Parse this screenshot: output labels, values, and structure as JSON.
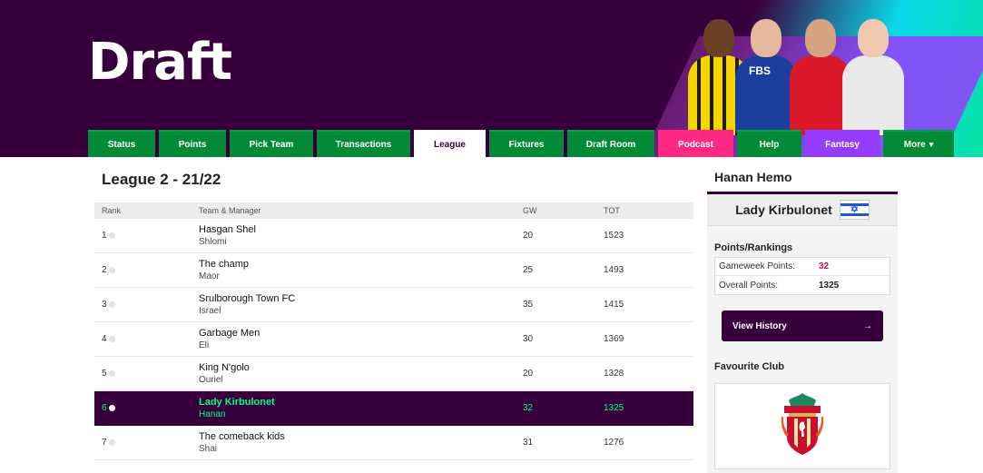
{
  "header": {
    "title": "Draft",
    "sponsor_text": "FBS"
  },
  "nav": {
    "tabs": [
      {
        "label": "Status",
        "width": 74,
        "style": "normal"
      },
      {
        "label": "Points",
        "width": 74,
        "style": "normal"
      },
      {
        "label": "Pick Team",
        "width": 92,
        "style": "normal"
      },
      {
        "label": "Transactions",
        "width": 103,
        "style": "normal"
      },
      {
        "label": "League",
        "width": 79,
        "style": "active"
      },
      {
        "label": "Fixtures",
        "width": 82,
        "style": "normal"
      },
      {
        "label": "Draft Room",
        "width": 96,
        "style": "normal"
      },
      {
        "label": "Podcast",
        "width": 83,
        "style": "podcast"
      },
      {
        "label": "Help",
        "width": 71,
        "style": "normal"
      },
      {
        "label": "Fantasy",
        "width": 82,
        "style": "fantasy"
      },
      {
        "label": "More",
        "width": 78,
        "style": "normal",
        "chevron": "▾"
      }
    ]
  },
  "league": {
    "title": "League 2 - 21/22",
    "columns": {
      "rank": "Rank",
      "team": "Team & Manager",
      "gw": "GW",
      "tot": "TOT"
    },
    "rows": [
      {
        "rank": "1",
        "team": "Hasgan Shel",
        "manager": "Shlomi",
        "gw": "20",
        "tot": "1523",
        "me": false
      },
      {
        "rank": "2",
        "team": "The champ",
        "manager": "Maor",
        "gw": "25",
        "tot": "1493",
        "me": false
      },
      {
        "rank": "3",
        "team": "Srulborough Town FC",
        "manager": "Israel",
        "gw": "35",
        "tot": "1415",
        "me": false
      },
      {
        "rank": "4",
        "team": "Garbage Men",
        "manager": "Eli",
        "gw": "30",
        "tot": "1369",
        "me": false
      },
      {
        "rank": "5",
        "team": "King N'golo",
        "manager": "Ouriel",
        "gw": "20",
        "tot": "1328",
        "me": false
      },
      {
        "rank": "6",
        "team": "Lady Kirbulonet",
        "manager": "Hanan",
        "gw": "32",
        "tot": "1325",
        "me": true
      },
      {
        "rank": "7",
        "team": "The comeback kids",
        "manager": "Shai",
        "gw": "31",
        "tot": "1276",
        "me": false
      }
    ]
  },
  "sidebar": {
    "owner_name": "Hanan Hemo",
    "team_name": "Lady Kirbulonet",
    "flag_icon": "israel-flag-icon",
    "points_title": "Points/Rankings",
    "gameweek_label": "Gameweek Points:",
    "gameweek_value": "32",
    "overall_label": "Overall Points:",
    "overall_value": "1325",
    "history_button": "View History",
    "history_arrow": "→",
    "favourite_title": "Favourite Club",
    "club_crest_icon": "liverpool-crest-icon"
  },
  "colors": {
    "brand_purple": "#37003c",
    "nav_green": "#028a36",
    "highlight_green": "#00ff87",
    "podcast_pink": "#ff2882",
    "fantasy_purple": "#963cff",
    "points_pink": "#e90052"
  }
}
